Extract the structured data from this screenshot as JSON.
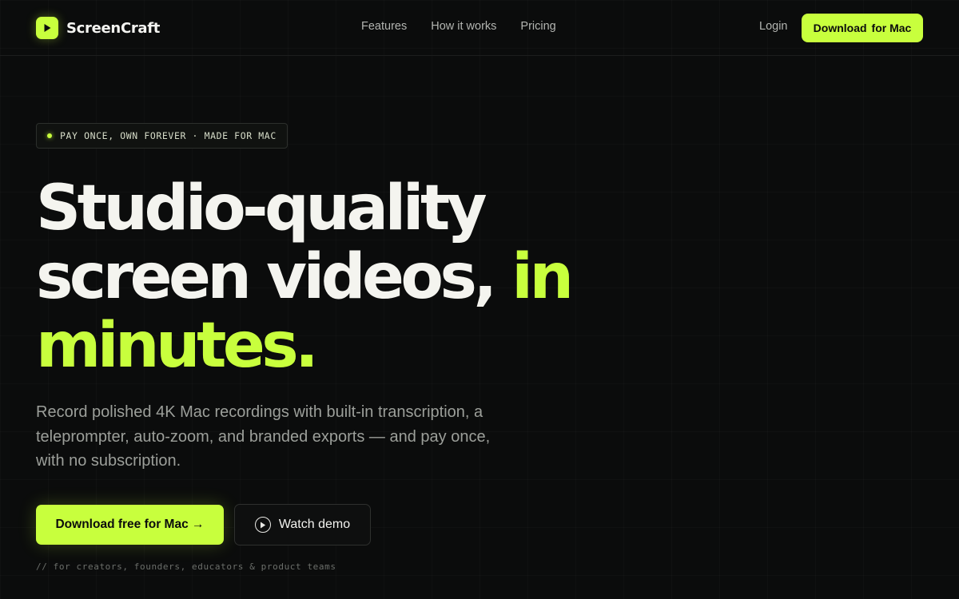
{
  "brand": {
    "name": "ScreenCraft",
    "logo_icon": "play-icon",
    "accent_color": "#c8ff3d",
    "background_color": "#0b0c0c"
  },
  "nav": {
    "links": [
      "Features",
      "How it works",
      "Pricing"
    ],
    "login_label": "Login",
    "cta_label": "Download",
    "cta_suffix": "for Mac"
  },
  "hero": {
    "badge_text": "PAY ONCE, OWN FOREVER · MADE FOR MAC",
    "headline_line1": "Studio-quality",
    "headline_line2": "screen videos,",
    "headline_accent": "in minutes.",
    "subtitle": "Record polished 4K Mac recordings with built-in transcription, a teleprompter, auto-zoom, and branded exports — and pay once, with no subscription.",
    "primary_cta": "Download free for Mac →",
    "secondary_cta": "Watch demo",
    "secondary_icon": "play-circle-icon",
    "footnote": "// for creators, founders, educators & product teams"
  }
}
